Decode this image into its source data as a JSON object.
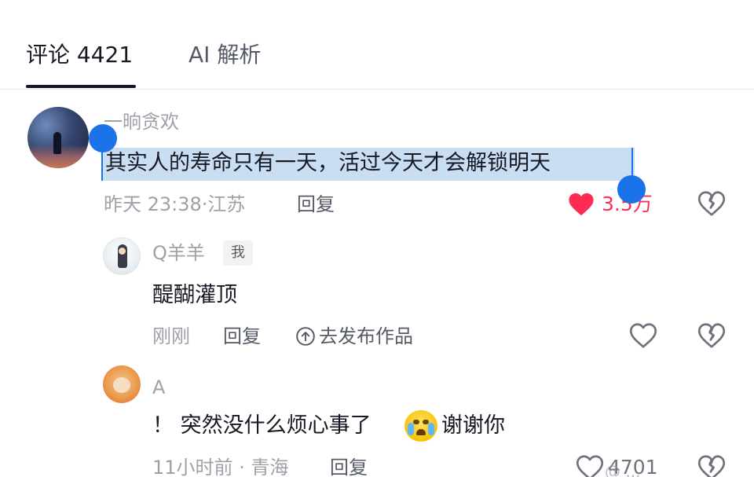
{
  "tabs": {
    "comments_label": "评论 4421",
    "ai_label": "AI 解析"
  },
  "comments": [
    {
      "username": "一晌贪欢",
      "text": "其实人的寿命只有一天，活过今天才会解锁明天",
      "time": "昨天 23:38·江苏",
      "reply_label": "回复",
      "likes": "3.5万",
      "liked": true,
      "selected": true,
      "avatar_icon": "night-sky-avatar"
    },
    {
      "username": "Q羊羊",
      "badge": "我",
      "text": "醍醐灌顶",
      "time": "刚刚",
      "reply_label": "回复",
      "publish_label": "去发布作品",
      "avatar_icon": "girl-avatar"
    },
    {
      "username": "A",
      "text_before": "！ 突然没什么烦心事了",
      "emoji": "crying-face-emoji",
      "text_after": "谢谢你",
      "time": "11小时前 · 青海",
      "reply_label": "回复",
      "likes": "4701",
      "avatar_icon": "cartoon-avatar"
    }
  ],
  "colors": {
    "liked_red": "#fe2c55",
    "selection_blue": "#1a73e8",
    "selection_bg": "#c9ddf3",
    "meta_gray": "#9ea1a8"
  },
  "watermark": "@ ..."
}
